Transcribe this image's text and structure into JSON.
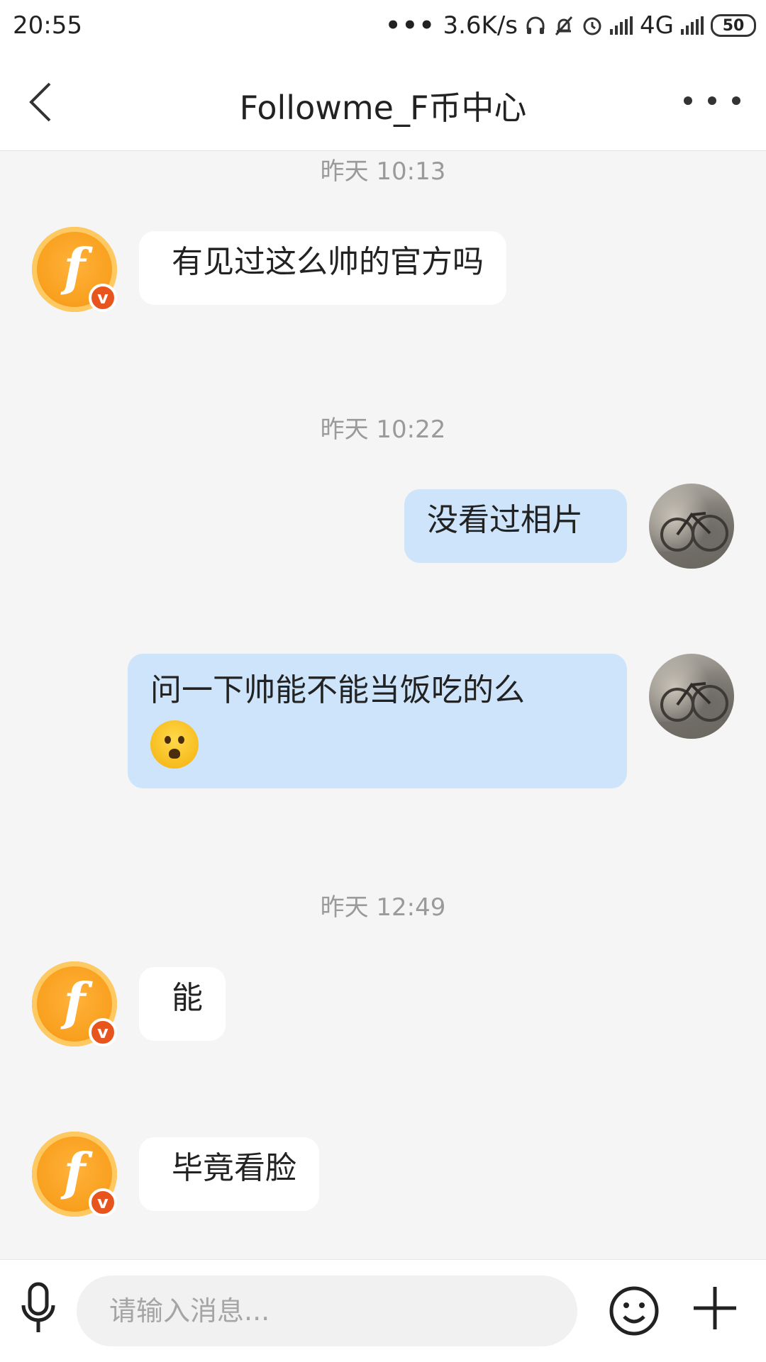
{
  "status_bar": {
    "time": "20:55",
    "dots": "•••",
    "speed": "3.6K/s",
    "network": "4G",
    "battery": "50"
  },
  "header": {
    "title": "Followme_F币中心"
  },
  "official_avatar": {
    "letter": "f",
    "badge": "v"
  },
  "messages": [
    {
      "timestamp": "昨天 10:13"
    },
    {
      "text": "有见过这么帅的官方吗"
    },
    {
      "timestamp": "昨天 10:22"
    },
    {
      "text": "没看过相片"
    },
    {
      "text": "问一下帅能不能当饭吃的么",
      "emoji": "frowning-face-with-open-mouth"
    },
    {
      "timestamp": "昨天 12:49"
    },
    {
      "text": "能"
    },
    {
      "text": "毕竟看脸"
    }
  ],
  "input": {
    "placeholder": "请输入消息..."
  },
  "colors": {
    "incoming_bubble": "#ffffff",
    "outgoing_bubble": "#cde4fb",
    "official_avatar": "#f9a01f",
    "verified_badge": "#e8541e",
    "background": "#f5f5f5"
  }
}
